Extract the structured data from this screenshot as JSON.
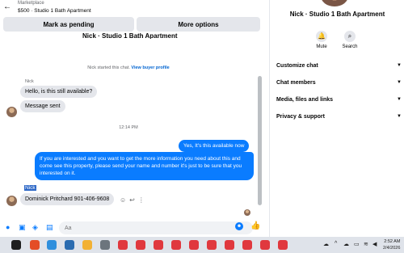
{
  "header": {
    "marketplace_label": "Marketplace",
    "listing_title": "$500 · Studio 1 Bath Apartment"
  },
  "actions": {
    "mark_pending": "Mark as pending",
    "more_options": "More options"
  },
  "partial_title": "Nick · Studio 1 Bath Apartment",
  "chat": {
    "started_note": "Nick started this chat.",
    "view_profile": "View buyer profile",
    "sender_name": "Nick",
    "incoming_1": "Hello, is this still available?",
    "incoming_2": "Message sent",
    "time_separator": "12:14 PM",
    "outgoing_1": "Yes, It's this available now",
    "outgoing_2": "If you are interested and you want to get the more information you need about this and come see this property, please send your name and number it's just to be sure that you interested on it.",
    "selected_name": "Nick",
    "incoming_3": "Dominick Pritchard 901-406-9608"
  },
  "composer": {
    "placeholder": "Aa"
  },
  "panel": {
    "title": "Nick · Studio 1 Bath Apartment",
    "mute_label": "Mute",
    "search_label": "Search",
    "rows": [
      "Customize chat",
      "Chat members",
      "Media, files and links",
      "Privacy & support"
    ]
  },
  "taskbar": {
    "time": "2:52 AM",
    "date": "2/4/2026"
  }
}
